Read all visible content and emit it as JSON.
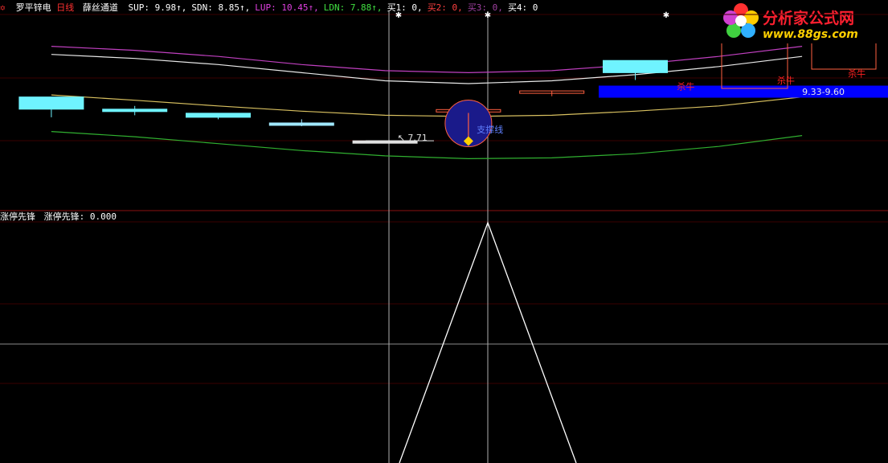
{
  "header": {
    "flag_icon": "star-flag-icon",
    "stock_name": "罗平锌电",
    "period": "日线",
    "indicator_name": "薛丝通道",
    "items": [
      {
        "text": "SUP: 9.98",
        "arrow": "↑",
        "color": "#ffffff"
      },
      {
        "text": "SDN: 8.85",
        "arrow": "↑",
        "color": "#ffffff"
      },
      {
        "text": "LUP: 10.45",
        "arrow": "↑",
        "color": "#e040e0"
      },
      {
        "text": "LDN: 7.88",
        "arrow": "↑",
        "color": "#40e040"
      },
      {
        "text": "买1: 0",
        "arrow": "",
        "color": "#ffffff"
      },
      {
        "text": "买2: 0",
        "arrow": "",
        "color": "#ff4040"
      },
      {
        "text": "买3: 0",
        "arrow": "",
        "color": "#a040a0"
      },
      {
        "text": "买4: 0",
        "arrow": "",
        "color": "#ffffff"
      }
    ],
    "colors": {
      "stock_name": "#ffffff",
      "period": "#ff3030",
      "indicator_name": "#ffffff",
      "flag": "#ff3030"
    }
  },
  "logo": {
    "icon": "flower-logo-icon",
    "title": "分析家公式网",
    "url": "www.88gs.com"
  },
  "subpanel": {
    "label_left": "涨停先锋",
    "label_value": "涨停先锋: 0.000"
  },
  "chart_data": [
    {
      "type": "line",
      "title": "薛丝通道",
      "x": [
        0,
        1,
        2,
        3,
        4,
        5,
        6,
        7,
        8,
        9
      ],
      "xlim": [
        -0.5,
        9.5
      ],
      "ylim": [
        6.9,
        11.1
      ],
      "series": [
        {
          "name": "LUP",
          "color": "#c040c0",
          "values": [
            10.95,
            10.85,
            10.7,
            10.5,
            10.35,
            10.3,
            10.35,
            10.5,
            10.7,
            10.95
          ]
        },
        {
          "name": "SUP",
          "color": "#e8e8e8",
          "values": [
            10.75,
            10.65,
            10.5,
            10.3,
            10.1,
            10.03,
            10.1,
            10.25,
            10.45,
            10.7
          ]
        },
        {
          "name": "SDN",
          "color": "#d8c060",
          "values": [
            9.75,
            9.62,
            9.48,
            9.35,
            9.25,
            9.22,
            9.25,
            9.35,
            9.48,
            9.7
          ]
        },
        {
          "name": "LDN",
          "color": "#30b030",
          "values": [
            8.85,
            8.72,
            8.55,
            8.38,
            8.25,
            8.18,
            8.2,
            8.3,
            8.48,
            8.75
          ]
        }
      ],
      "candles": [
        {
          "x": 0,
          "open": 9.4,
          "close": 9.7,
          "high": 9.7,
          "low": 9.2,
          "color": "#6ff3ff"
        },
        {
          "x": 1,
          "open": 9.35,
          "close": 9.4,
          "high": 9.48,
          "low": 9.25,
          "color": "#6ff3ff"
        },
        {
          "x": 2,
          "open": 9.2,
          "close": 9.3,
          "high": 9.3,
          "low": 9.15,
          "color": "#6ff3ff"
        },
        {
          "x": 3,
          "open": 9.06,
          "close": 9.06,
          "high": 9.15,
          "low": 8.98,
          "color": "#a0e8ff"
        },
        {
          "x": 4,
          "open": 8.62,
          "close": 8.62,
          "high": 8.62,
          "low": 8.62,
          "color": "#e0e0e0"
        },
        {
          "x": 5,
          "open": 9.39,
          "close": 9.39,
          "high": 9.4,
          "low": 8.82,
          "color": "#ff6040"
        },
        {
          "x": 6,
          "open": 9.85,
          "close": 9.82,
          "high": 9.85,
          "low": 9.72,
          "color": "#ff6040"
        },
        {
          "x": 7,
          "open": 10.3,
          "close": 10.6,
          "high": 10.6,
          "low": 10.12,
          "color": "#6ff3ff"
        }
      ],
      "annotations": [
        {
          "text": "↖ 7.71",
          "color": "#e0e0e0",
          "x": 4.15,
          "y": 8.62
        },
        {
          "text": "支撑线",
          "color": "#6080ff",
          "x": 5.1,
          "y": 8.82
        },
        {
          "text": "杀牛",
          "color": "#ff2020",
          "x": 7.5,
          "y": 9.88
        },
        {
          "text": "杀牛",
          "color": "#ff2020",
          "x": 8.7,
          "y": 10.03
        },
        {
          "text": "杀牛",
          "color": "#ff2020",
          "x": 9.55,
          "y": 10.2
        },
        {
          "text": "9.33-9.60",
          "color": "#e8e8e8",
          "x": 9.0,
          "y": 9.75
        }
      ]
    },
    {
      "type": "line",
      "title": "涨停先锋",
      "x": [
        0,
        1,
        2
      ],
      "ylim": [
        0,
        1
      ],
      "series": [
        {
          "name": "涨停先锋",
          "color": "#ffffff",
          "values": [
            0,
            1,
            0
          ]
        }
      ]
    }
  ]
}
